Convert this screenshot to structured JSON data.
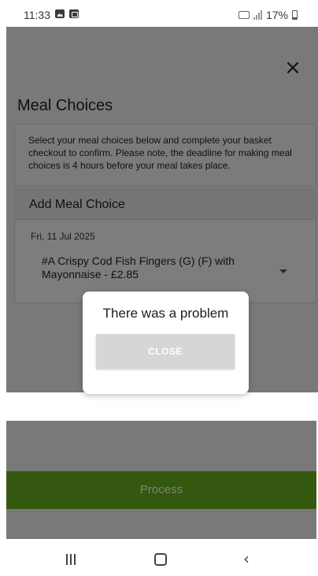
{
  "status_bar": {
    "time": "11:33",
    "battery": "17%",
    "icons": [
      "photo-icon",
      "payment-icon",
      "vowifi-icon",
      "signal-icon",
      "battery-icon"
    ]
  },
  "page": {
    "close_icon": "close-icon",
    "title": "Meal Choices",
    "info_text": "Select your meal choices below and complete your basket checkout to confirm. Please note, the deadline for making meal choices is 4 hours before your meal takes place.",
    "add_meal": {
      "header": "Add Meal Choice",
      "date": "Fri, 11 Jul 2025",
      "selected_meal": "#A Crispy Cod Fish Fingers (G) (F) with Mayonnaise  - £2.85"
    },
    "process_label": "Process"
  },
  "dialog": {
    "title": "There was a problem",
    "close_label": "CLOSE"
  },
  "nav_bar": {
    "recents_icon": "recents-icon",
    "home_icon": "home-icon",
    "back_icon": "back-icon"
  },
  "colors": {
    "accent_green": "#6ab023",
    "overlay": "rgba(0,0,0,0.5)",
    "dialog_button": "#d6d6d6"
  }
}
